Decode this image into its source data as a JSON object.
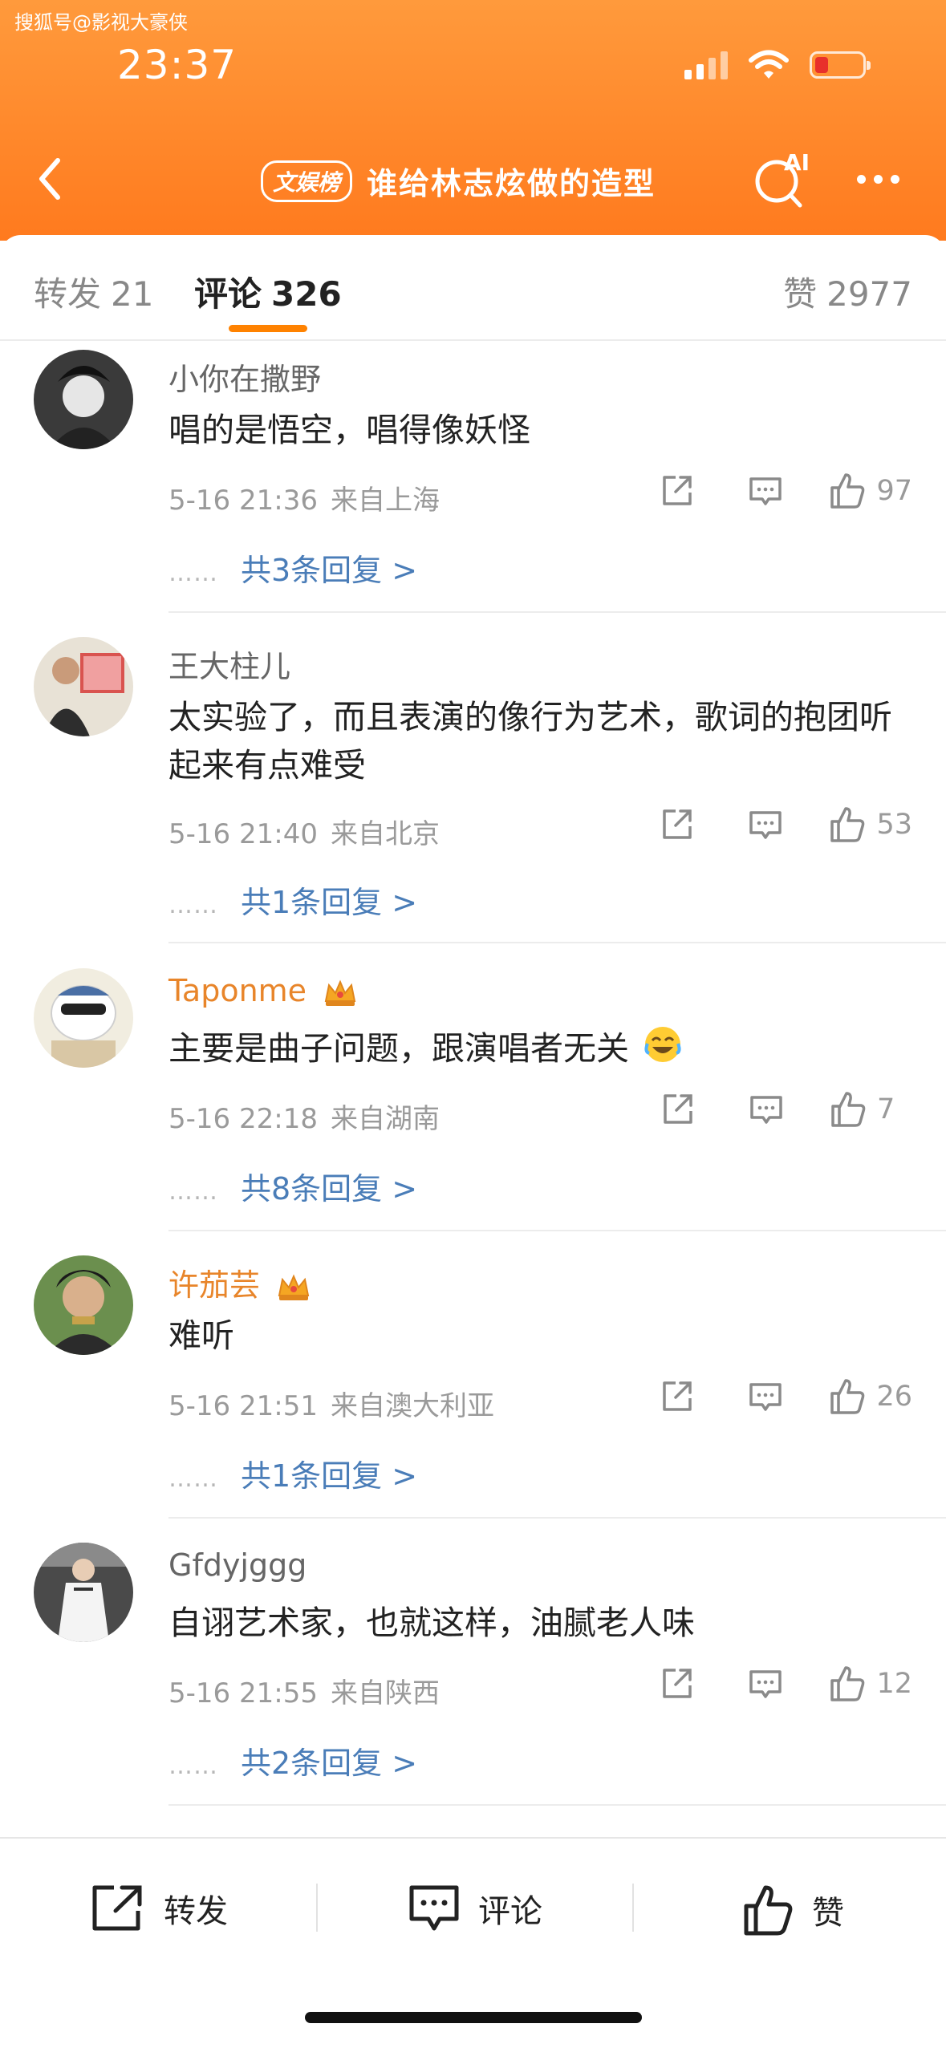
{
  "watermark": "搜狐号@影视大豪侠",
  "status_bar": {
    "time": "23:37"
  },
  "nav": {
    "badge": "文娱榜",
    "title": "谁给林志炫做的造型",
    "ai_label": "AI"
  },
  "tabs": {
    "repost": {
      "label": "转发",
      "count": "21"
    },
    "comment": {
      "label": "评论",
      "count": "326"
    },
    "like": {
      "label": "赞",
      "count": "2977"
    }
  },
  "comments": [
    {
      "name": "小你在撒野",
      "text": "唱的是悟空，唱得像妖怪",
      "date": "5-16 21:36",
      "location": "来自上海",
      "likes": "97",
      "replies": "共3条回复 >",
      "vip": false
    },
    {
      "name": "王大柱儿",
      "text": "太实验了，而且表演的像行为艺术，歌词的抱团听起来有点难受",
      "date": "5-16 21:40",
      "location": "来自北京",
      "likes": "53",
      "replies": "共1条回复 >",
      "vip": false
    },
    {
      "name": "Taponme",
      "text": "主要是曲子问题，跟演唱者无关",
      "date": "5-16 22:18",
      "location": "来自湖南",
      "likes": "7",
      "replies": "共8条回复 >",
      "vip": true
    },
    {
      "name": "许茄芸",
      "text": "难听",
      "date": "5-16 21:51",
      "location": "来自澳大利亚",
      "likes": "26",
      "replies": "共1条回复 >",
      "vip": true
    },
    {
      "name": "Gfdyjggg",
      "text": "自诩艺术家，也就这样，油腻老人味",
      "date": "5-16 21:55",
      "location": "来自陕西",
      "likes": "12",
      "replies": "共2条回复 >",
      "vip": false
    }
  ],
  "bottom_bar": {
    "repost": "转发",
    "comment": "评论",
    "like": "赞"
  },
  "colors": {
    "header": "#ff8a2a",
    "accent": "#ff8200",
    "link": "#4a7db8",
    "vip_name": "#e8852a"
  }
}
